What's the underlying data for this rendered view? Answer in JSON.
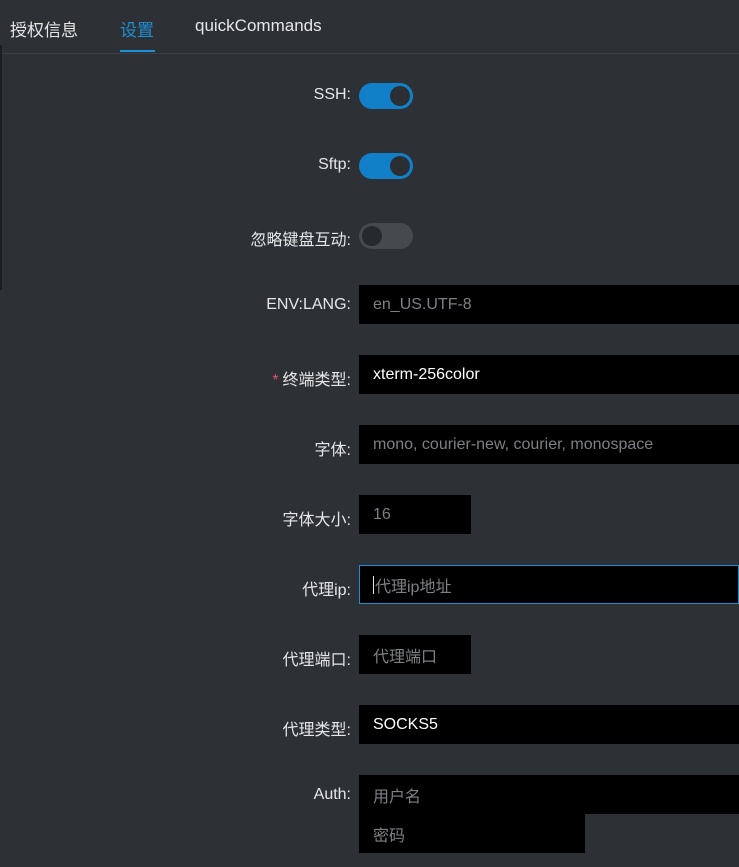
{
  "tabs": [
    {
      "label": "授权信息"
    },
    {
      "label": "设置"
    },
    {
      "label": "quickCommands"
    }
  ],
  "form": {
    "ssh": {
      "label": "SSH:",
      "on": true
    },
    "sftp": {
      "label": "Sftp:",
      "on": true
    },
    "ignore_keyboard": {
      "label": "忽略键盘互动:",
      "on": false
    },
    "env_lang": {
      "label": "ENV:LANG:",
      "placeholder": "en_US.UTF-8"
    },
    "term_type": {
      "required_mark": "*",
      "label": "终端类型:",
      "value": "xterm-256color"
    },
    "font": {
      "label": "字体:",
      "placeholder": "mono, courier-new, courier, monospace"
    },
    "font_size": {
      "label": "字体大小:",
      "placeholder": "16"
    },
    "proxy_ip": {
      "label": "代理ip:",
      "placeholder": "代理ip地址"
    },
    "proxy_port": {
      "label": "代理端口:",
      "placeholder": "代理端口"
    },
    "proxy_type": {
      "label": "代理类型:",
      "value": "SOCKS5"
    },
    "auth": {
      "label": "Auth:",
      "username_placeholder": "用户名",
      "password_placeholder": "密码"
    }
  },
  "colors": {
    "accent": "#1e8fd6",
    "background": "#2d3136",
    "input_bg": "#000000"
  }
}
